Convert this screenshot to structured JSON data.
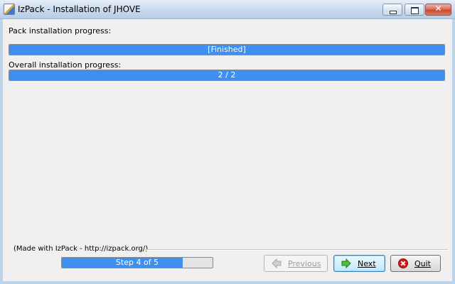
{
  "window": {
    "title": "IzPack - Installation of  JHOVE"
  },
  "titlebar_buttons": {
    "minimize_icon": "minimize-icon",
    "maximize_icon": "maximize-icon",
    "close_icon": "close-icon",
    "close_glyph": "✕"
  },
  "pack_progress": {
    "label": "Pack installation progress:",
    "text": "[Finished]",
    "value": 1.0
  },
  "overall_progress": {
    "label": "Overall installation progress:",
    "text": "2 / 2",
    "value": 1.0
  },
  "footer": {
    "made_with": "(Made with IzPack - http://izpack.org/)"
  },
  "step_progress": {
    "text": "Step 4 of 5",
    "value": 0.8
  },
  "buttons": {
    "previous": {
      "label": "Previous",
      "enabled": false,
      "icon": "arrow-left-icon"
    },
    "next": {
      "label": "Next",
      "enabled": true,
      "icon": "arrow-right-icon"
    },
    "quit": {
      "label": "Quit",
      "enabled": true,
      "icon": "quit-icon"
    }
  },
  "colors": {
    "progress_fill": "#3e8ff0",
    "client_bg": "#f0f0f0",
    "quit_icon": "#d01818",
    "next_icon": "#2e9a2e"
  }
}
